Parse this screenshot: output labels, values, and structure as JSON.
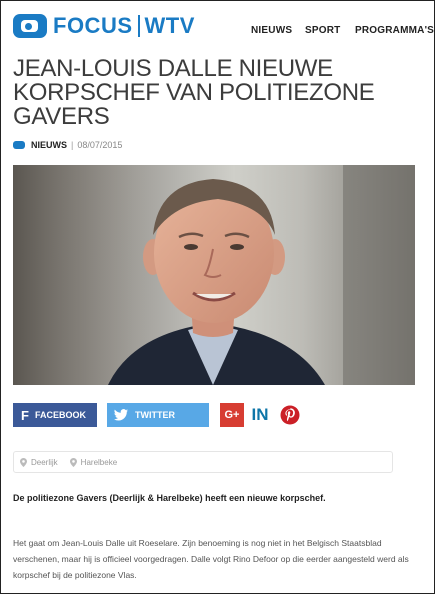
{
  "header": {
    "logo_left": "FOCUS",
    "logo_right": "WTV",
    "nav": [
      "NIEUWS",
      "SPORT",
      "PROGRAMMA'S"
    ]
  },
  "article": {
    "title": "JEAN-LOUIS DALLE NIEUWE KORPSCHEF VAN POLITIEZONE GAVERS",
    "category": "NIEUWS",
    "separator": "|",
    "date": "08/07/2015",
    "lead": "De politiezone Gavers (Deerlijk & Harelbeke) heeft een nieuwe korpschef.",
    "body": "Het gaat om Jean-Louis Dalle uit Roeselare. Zijn benoeming is nog niet in het Belgisch Staatsblad verschenen, maar hij is officieel voorgedragen. Dalle volgt Rino Defoor op die eerder aangesteld werd als korpschef bij de politiezone Vlas."
  },
  "share": {
    "facebook": "FACEBOOK",
    "twitter": "TWITTER",
    "googleplus": "G+",
    "linkedin": "in",
    "pinterest": "P"
  },
  "tags": [
    "Deerlijk",
    "Harelbeke"
  ],
  "colors": {
    "brand": "#1a7bc4",
    "facebook": "#3b5998",
    "twitter": "#58a8e6",
    "googleplus": "#d73d32",
    "linkedin": "#0e76a8",
    "pinterest": "#cb2027"
  }
}
